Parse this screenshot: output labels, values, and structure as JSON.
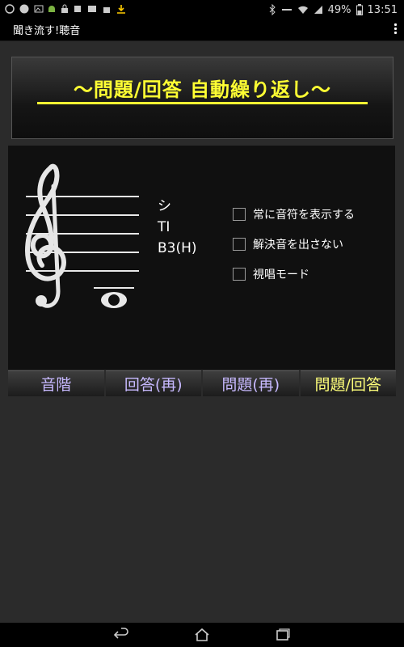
{
  "status_bar": {
    "notification_icons": [
      "whatsapp-icon",
      "badge-icon",
      "image-icon",
      "android-icon",
      "lock-icon",
      "app-icon",
      "mail-icon",
      "store-icon",
      "download-icon"
    ],
    "battery": "49%",
    "time": "13:51",
    "colors": {
      "android": "#7cb342",
      "download": "#ffcc00"
    }
  },
  "action_bar": {
    "title": "聞き流す!聴音",
    "overflow_icon": "overflow-menu-icon"
  },
  "banner": {
    "text": "～問題/回答 自動繰り返し～",
    "color": "#ffff33"
  },
  "note_display": {
    "clef": "treble-clef-icon",
    "names": [
      "シ",
      "TI",
      "B3(H)"
    ]
  },
  "options": [
    {
      "label": "常に音符を表示する",
      "checked": false
    },
    {
      "label": "解決音を出さない",
      "checked": false
    },
    {
      "label": "視唱モード",
      "checked": false
    }
  ],
  "tabs": [
    {
      "label": "音階",
      "active": false
    },
    {
      "label": "回答(再)",
      "active": false
    },
    {
      "label": "問題(再)",
      "active": false
    },
    {
      "label": "問題/回答",
      "active": true
    }
  ],
  "tab_colors": {
    "default": "#c7b9ff",
    "active": "#ffff7a"
  },
  "nav_bar": {
    "icons": [
      "back-icon",
      "home-icon",
      "recents-icon"
    ]
  }
}
